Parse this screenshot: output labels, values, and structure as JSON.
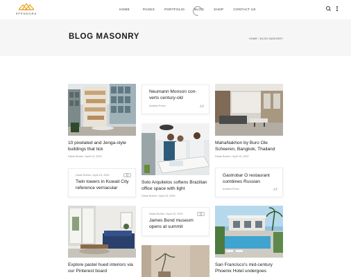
{
  "header": {
    "logo_text": "SPENDORA",
    "nav": [
      "HOME",
      "PAGES",
      "PORTFOLIO",
      "BLOG",
      "SHOP",
      "CONTACT US"
    ]
  },
  "title_bar": {
    "title": "BLOG MASONRY",
    "breadcrumb_home": "HOME",
    "breadcrumb_sep": " / ",
    "breadcrumb_current": "BLOG MASONRY"
  },
  "posts": {
    "p1": {
      "title": "10 pixelated and Jenga-style buildings that tick",
      "author": "Diane Burton",
      "date": "April 15, 2020"
    },
    "p2": {
      "title": "Neumann Monson con-verts century-old",
      "author": "Andrew Perez"
    },
    "p3": {
      "title": "MahaNakhon by Buro Ole Scheeren, Bangkok, Thailand",
      "author": "Diane Burton",
      "date": "April 15, 2020"
    },
    "p4": {
      "title": "Twin towers in Kuwait City reference vernacular",
      "author": "Diane Burton",
      "date": "April 15, 2020"
    },
    "p5": {
      "title": "Solo Arquitetos softens Brazilian office space with light",
      "author": "Diane Burton",
      "date": "April 15, 2020"
    },
    "p6": {
      "title": "Gastrobar O restaurant combines Russian",
      "author": "Andrew Perez"
    },
    "p7": {
      "title": "James Bond museum opens at summit",
      "author": "Diane Burton",
      "date": "April 15, 2020"
    },
    "p8": {
      "title": "Explore pastel hued interiors via our Pinterest board"
    },
    "p9": {
      "title": "San Francisco's mid-century Phoenix Hotel undergoes"
    }
  },
  "meta_sep": " / ",
  "colors": {
    "accent": "#e8a21a",
    "title_bar_bg": "#f6f6f6"
  },
  "icons": [
    "logo-mark",
    "search-icon",
    "kebab-menu-icon",
    "quote-icon",
    "link-icon"
  ]
}
